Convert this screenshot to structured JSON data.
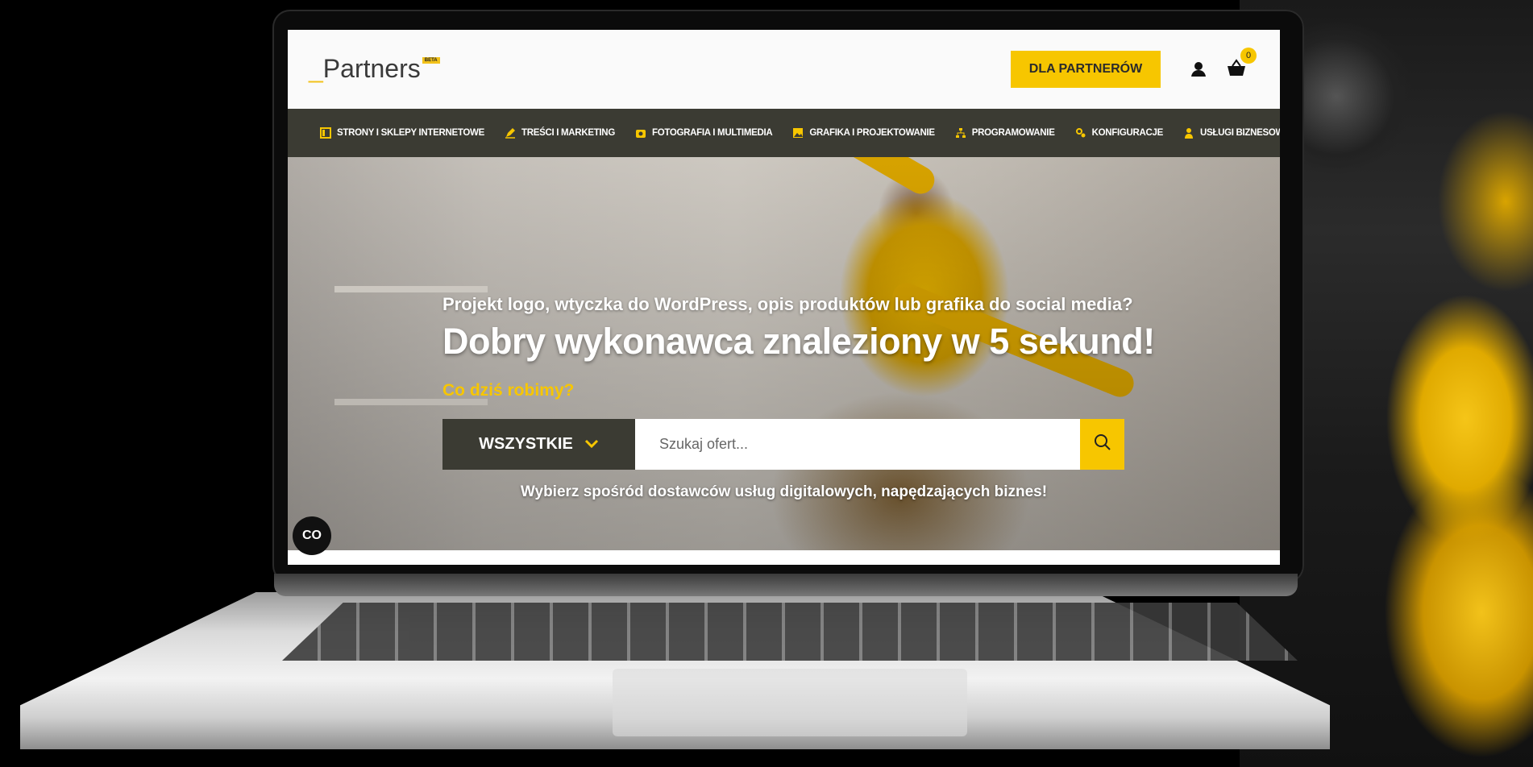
{
  "colors": {
    "accent": "#f7c600",
    "dark": "#3b3b33"
  },
  "header": {
    "logo_prefix": "_",
    "logo_text": "Partners",
    "logo_badge": "BETA",
    "partner_button": "DLA PARTNERÓW",
    "cart_count": "0",
    "icons": [
      "user-icon",
      "cart-icon"
    ]
  },
  "categories": [
    {
      "label": "STRONY I SKLEPY INTERNETOWE",
      "icon": "layout-icon"
    },
    {
      "label": "TREŚCI I MARKETING",
      "icon": "pencil-icon"
    },
    {
      "label": "FOTOGRAFIA I MULTIMEDIA",
      "icon": "camera-icon"
    },
    {
      "label": "GRAFIKA I PROJEKTOWANIE",
      "icon": "image-icon"
    },
    {
      "label": "PROGRAMOWANIE",
      "icon": "sitemap-icon"
    },
    {
      "label": "KONFIGURACJE",
      "icon": "gears-icon"
    },
    {
      "label": "USŁUGI BIZNESOWE",
      "icon": "businessman-icon"
    }
  ],
  "hero": {
    "subtitle": "Projekt logo, wtyczka do WordPress, opis produktów lub grafika do social media?",
    "title": "Dobry wykonawca znaleziony w 5 sekund!",
    "question": "Co dziś robimy?",
    "dropdown": "WSZYSTKIE",
    "search_placeholder": "Szukaj ofert...",
    "note": "Wybierz spośród dostawców usług digitalowych, napędzających biznes!"
  },
  "cookie_button": "CO"
}
